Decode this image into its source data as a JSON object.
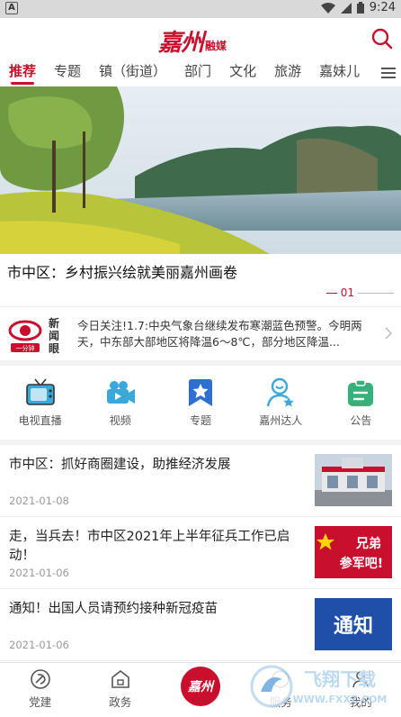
{
  "status_bar": {
    "left_badge": "A",
    "time": "9:24"
  },
  "header": {
    "logo_main": "嘉州",
    "logo_sub": "融媒"
  },
  "tabs": [
    {
      "label": "推荐"
    },
    {
      "label": "专题"
    },
    {
      "label": "镇（街道）"
    },
    {
      "label": "部门"
    },
    {
      "label": "文化"
    },
    {
      "label": "旅游"
    },
    {
      "label": "嘉妹儿"
    }
  ],
  "hero": {
    "title": "市中区：乡村振兴绘就美丽嘉州画卷",
    "page": "01"
  },
  "news_strip": {
    "logo_top": "新闻眼",
    "logo_bottom": "一分钟",
    "text": "今日关注!1.7:中央气象台继续发布寒潮蓝色预警。今明两天，中东部大部地区将降温6～8℃，部分地区降温..."
  },
  "quick_links": [
    {
      "label": "电视直播",
      "icon": "tv-icon",
      "color": "#3aa8d8"
    },
    {
      "label": "视频",
      "icon": "video-camera-icon",
      "color": "#3aa8d8"
    },
    {
      "label": "专题",
      "icon": "star-bookmark-icon",
      "color": "#2f6fd1"
    },
    {
      "label": "嘉州达人",
      "icon": "person-star-icon",
      "color": "#3aa8d8"
    },
    {
      "label": "公告",
      "icon": "notice-icon",
      "color": "#34b27a"
    }
  ],
  "news": [
    {
      "title": "市中区：抓好商圈建设，助推经济发展",
      "date": "2021-01-08"
    },
    {
      "title": "走，当兵去！市中区2021年上半年征兵工作已启动！",
      "date": "2021-01-06",
      "thumb_text": "兄弟参军吧!"
    },
    {
      "title": "通知！出国人员请预约接种新冠疫苗",
      "date": "2021-01-06",
      "thumb_text": "通知"
    }
  ],
  "bottom_nav": [
    {
      "label": "党建",
      "icon": "party-emblem-icon"
    },
    {
      "label": "政务",
      "icon": "government-icon"
    },
    {
      "label": "",
      "icon": "jiazhou-logo-icon",
      "text": "嘉州"
    },
    {
      "label": "服务",
      "icon": "service-icon"
    },
    {
      "label": "我的",
      "icon": "profile-icon"
    }
  ],
  "watermark": {
    "text": "飞翔下载",
    "url": "WWW.FXXZ.COM"
  },
  "colors": {
    "accent": "#c8102e"
  }
}
